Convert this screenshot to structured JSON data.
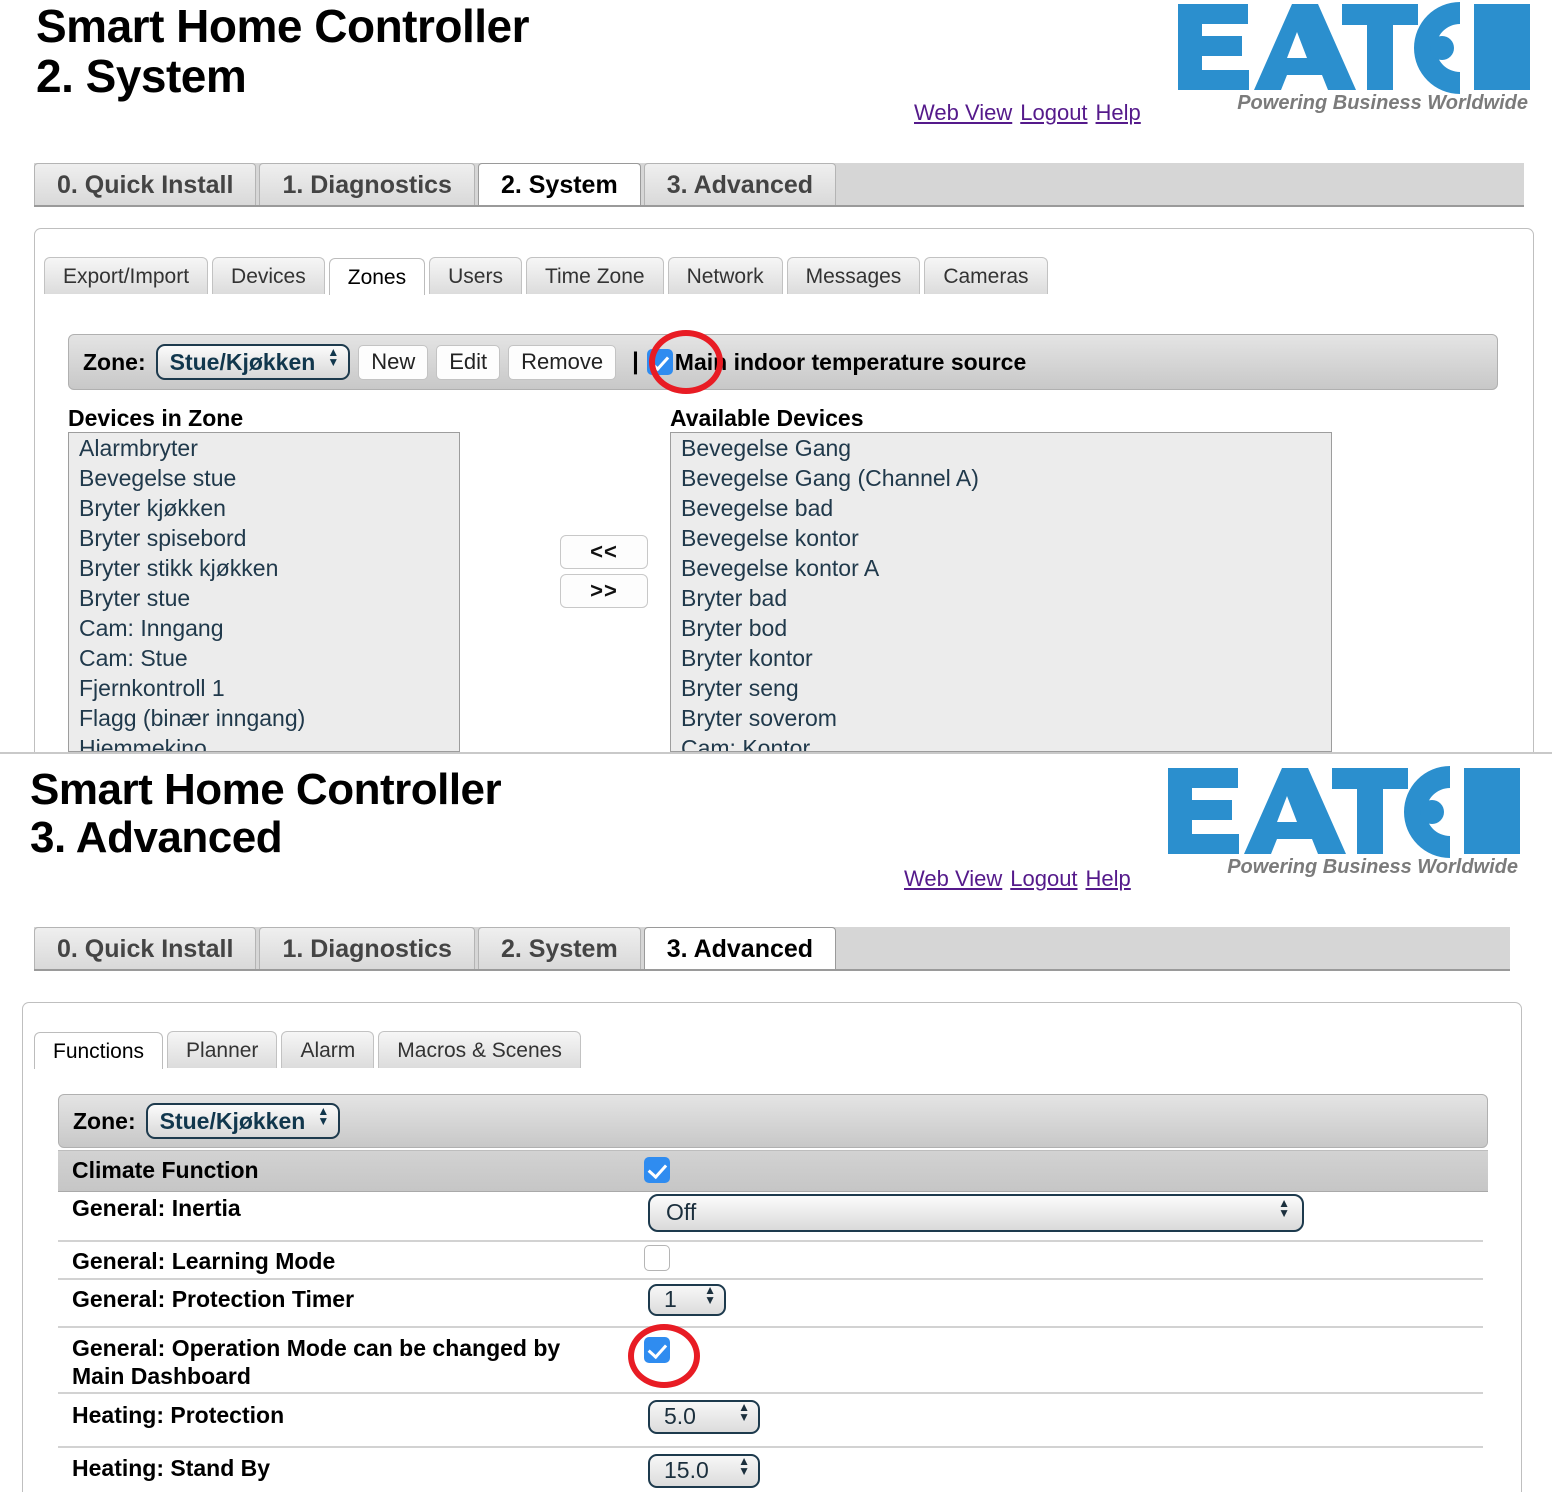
{
  "brand": {
    "logo_text": "EAT·N",
    "logo_tagline": "Powering Business Worldwide",
    "logo_color": "#2b8fce"
  },
  "panels": [
    {
      "title": "Smart Home Controller\n2. System",
      "header_links": [
        {
          "label": "Web View"
        },
        {
          "label": "Logout"
        },
        {
          "label": "Help"
        }
      ],
      "main_tabs": [
        {
          "label": "0. Quick Install",
          "active": false
        },
        {
          "label": "1. Diagnostics",
          "active": false
        },
        {
          "label": "2. System",
          "active": true
        },
        {
          "label": "3. Advanced",
          "active": false
        }
      ],
      "sub_tabs": [
        {
          "label": "Export/Import",
          "active": false
        },
        {
          "label": "Devices",
          "active": false
        },
        {
          "label": "Zones",
          "active": true
        },
        {
          "label": "Users",
          "active": false
        },
        {
          "label": "Time Zone",
          "active": false
        },
        {
          "label": "Network",
          "active": false
        },
        {
          "label": "Messages",
          "active": false
        },
        {
          "label": "Cameras",
          "active": false
        }
      ],
      "zone_toolbar": {
        "label": "Zone:",
        "selected_zone": "Stue/Kjøkken",
        "buttons": [
          "New",
          "Edit",
          "Remove"
        ],
        "separator": "|",
        "checkbox_label": "Main indoor temperature source",
        "checkbox_checked": true
      },
      "devices_in_zone": {
        "heading": "Devices in Zone",
        "items": [
          "Alarmbryter",
          "Bevegelse stue",
          "Bryter kjøkken",
          "Bryter spisebord",
          "Bryter stikk kjøkken",
          "Bryter stue",
          "Cam: Inngang",
          "Cam: Stue",
          "Fjernkontroll 1",
          "Flagg (binær inngang)",
          "Hjemmekino"
        ]
      },
      "available_devices": {
        "heading": "Available Devices",
        "items": [
          "Bevegelse Gang",
          "Bevegelse Gang (Channel A)",
          "Bevegelse bad",
          "Bevegelse kontor",
          "Bevegelse kontor A",
          "Bryter bad",
          "Bryter bod",
          "Bryter kontor",
          "Bryter seng",
          "Bryter soverom",
          "Cam: Kontor"
        ]
      },
      "transfer_buttons": {
        "move_left": "<<",
        "move_right": ">>"
      },
      "annotation_color": "#e81c24"
    },
    {
      "title": "Smart Home Controller\n3. Advanced",
      "header_links": [
        {
          "label": "Web View"
        },
        {
          "label": "Logout"
        },
        {
          "label": "Help"
        }
      ],
      "main_tabs": [
        {
          "label": "0. Quick Install",
          "active": false
        },
        {
          "label": "1. Diagnostics",
          "active": false
        },
        {
          "label": "2. System",
          "active": false
        },
        {
          "label": "3. Advanced",
          "active": true
        }
      ],
      "sub_tabs": [
        {
          "label": "Functions",
          "active": true
        },
        {
          "label": "Planner",
          "active": false
        },
        {
          "label": "Alarm",
          "active": false
        },
        {
          "label": "Macros & Scenes",
          "active": false
        }
      ],
      "zone_toolbar": {
        "label": "Zone:",
        "selected_zone": "Stue/Kjøkken"
      },
      "function_rows": [
        {
          "label": "Climate Function",
          "control": "checkbox",
          "value": "checked",
          "highlight": true
        },
        {
          "label": "General: Inertia",
          "control": "wide-select",
          "value": "Off"
        },
        {
          "label": "General: Learning Mode",
          "control": "checkbox",
          "value": "unchecked"
        },
        {
          "label": "General: Protection Timer",
          "control": "spinner",
          "value": "1"
        },
        {
          "label": "General: Operation Mode can be changed by\nMain Dashboard",
          "control": "checkbox",
          "value": "checked"
        },
        {
          "label": "Heating: Protection",
          "control": "spinner",
          "value": "5.0"
        },
        {
          "label": "Heating: Stand By",
          "control": "spinner",
          "value": "15.0"
        }
      ],
      "annotation_color": "#e81c24"
    }
  ]
}
